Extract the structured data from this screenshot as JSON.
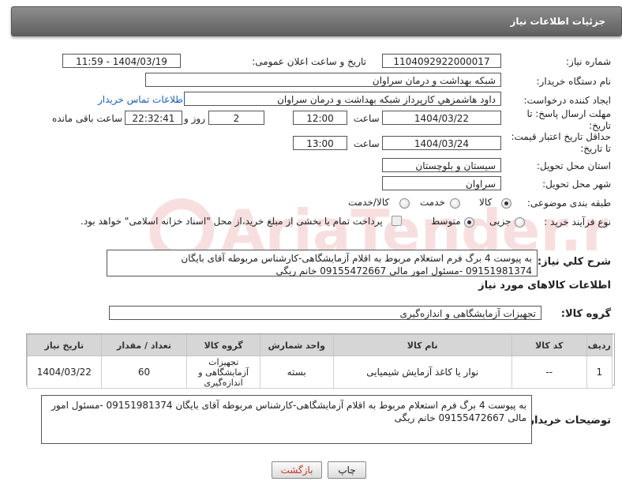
{
  "header": {
    "title": "جزئیات اطلاعات نیاز"
  },
  "labels": {
    "need_number": "شماره نیاز:",
    "announce_datetime": "تاریخ و ساعت اعلان عمومی:",
    "buyer_org": "نام دستگاه خریدار:",
    "requester": "ایجاد کننده درخواست:",
    "contact_link": "اطلاعات تماس خریدار",
    "reply_deadline": "مهلت ارسال پاسخ: تا تاریخ:",
    "time": "ساعت",
    "days_and": "روز و",
    "remaining": "ساعت باقی مانده",
    "price_validity": "حداقل تاریخ اعتبار قیمت: تا تاریخ:",
    "delivery_province": "استان محل تحویل:",
    "delivery_city": "شهر محل تحویل:",
    "category": "طبقه بندی موضوعی:",
    "purchase_type": "نوع فرآیند خرید :",
    "general_desc": "شرح کلي نياز:",
    "goods_info": "اطلاعات کالاهای مورد نیاز",
    "goods_group": "گروه کالا:",
    "buyer_notes": "توضیحات خریدار:"
  },
  "fields": {
    "need_number": "1104092922000017",
    "announce_datetime": "1404/03/19 - 11:59",
    "buyer_org": "شبکه بهداشت و درمان سراوان",
    "requester": "داود هاشمزهي  کارپرداز شبکه بهداشت و درمان سراوان",
    "reply_date": "1404/03/22",
    "reply_time": "12:00",
    "days": "2",
    "remaining_time": "22:32:41",
    "validity_date": "1404/03/24",
    "validity_time": "13:00",
    "province": "سیستان و بلوچستان",
    "city": "سراوان",
    "goods_group": "تجهیزات آزمایشگاهی و اندازه‌گیری",
    "general_desc": "به پیوست 4 برگ فرم استعلام مربوط به اقلام آزمایشگاهی-کارشناس مربوطه آقای بایگان  09151981374 -مسئول امور مالی 09155472667 خانم ریگی",
    "buyer_notes": "به پیوست 4 برگ فرم استعلام مربوط به اقلام آزمایشگاهی-کارشناس مربوطه آقای بایگان  09151981374 -مسئول امور مالی 09155472667 خانم ریگی"
  },
  "category_options": {
    "goods": "کالا",
    "service": "خدمت",
    "goods_service": "کالا/خدمت",
    "selected": "goods"
  },
  "purchase_options": {
    "minor": "جزیی",
    "medium": "متوسط",
    "selected": "medium",
    "treasury_note": "پرداخت تمام یا بخشی از مبلغ خرید،از محل \"اسناد خزانه اسلامی\" خواهد بود."
  },
  "table": {
    "headers": [
      "ردیف",
      "کد کالا",
      "نام کالا",
      "واحد شمارش",
      "گروه کالا",
      "تعداد / مقدار",
      "تاریخ نیاز"
    ],
    "rows": [
      [
        "1",
        "--",
        "نوار یا کاغذ آزمایش شیمیایی",
        "بسته",
        "تجهیزات آزمایشگاهی و اندازه‌گیری",
        "60",
        "1404/03/22"
      ]
    ]
  },
  "buttons": {
    "print": "چاپ",
    "back": "بازگشت"
  },
  "watermark": {
    "text": "AriaTender.net"
  },
  "colors": {
    "header_bg": "#6f6f6f",
    "link": "#1a5fb4",
    "back_btn_text": "#c0392b"
  }
}
